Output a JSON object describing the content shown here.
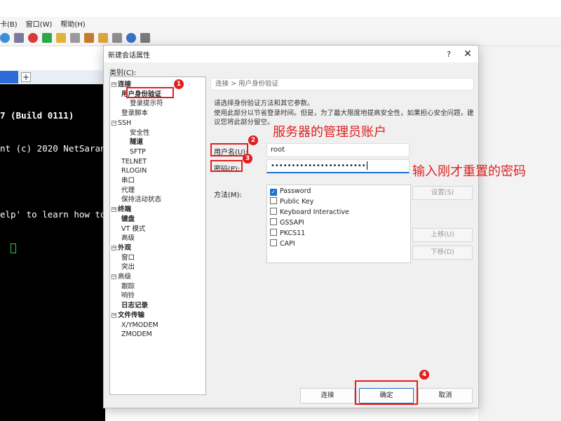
{
  "app": {
    "menu": [
      "卡(B)",
      "窗口(W)",
      "帮助(H)"
    ],
    "tab_label": "",
    "terminal_lines": [
      "7 (Build 0111)",
      "nt (c) 2020 NetSaran",
      "",
      "elp' to learn how to"
    ]
  },
  "dialog": {
    "title": "新建会话属性",
    "help": "?",
    "close": "✕",
    "category_label": "类别(C):",
    "tree": [
      {
        "label": "连接",
        "bold": true,
        "toggle": "−"
      },
      {
        "label": "用户身份验证",
        "bold": true
      },
      {
        "label": "登录提示符"
      },
      {
        "label": "登录脚本"
      },
      {
        "label": "SSH",
        "toggle": "−"
      },
      {
        "label": "安全性"
      },
      {
        "label": "隧道",
        "bold": true
      },
      {
        "label": "SFTP"
      },
      {
        "label": "TELNET"
      },
      {
        "label": "RLOGIN"
      },
      {
        "label": "串口"
      },
      {
        "label": "代理"
      },
      {
        "label": "保持活动状态"
      },
      {
        "label": "终端",
        "bold": true,
        "toggle": "−"
      },
      {
        "label": "键盘",
        "bold": true
      },
      {
        "label": "VT 模式"
      },
      {
        "label": "高级"
      },
      {
        "label": "外观",
        "bold": true,
        "toggle": "−"
      },
      {
        "label": "窗口"
      },
      {
        "label": "突出"
      },
      {
        "label": "高级",
        "toggle": "−"
      },
      {
        "label": "跟踪"
      },
      {
        "label": "响铃"
      },
      {
        "label": "日志记录",
        "bold": true
      },
      {
        "label": "文件传输",
        "bold": true,
        "toggle": "−"
      },
      {
        "label": "X/YMODEM"
      },
      {
        "label": "ZMODEM"
      }
    ],
    "header_path": "连接 > 用户身份验证",
    "desc1": "请选择身份验证方法和其它参数。",
    "desc2": "使用此部分以节省登录时间。但是，为了最大限度地提高安全性，如果担心安全问题，建议您将此部分留空。",
    "username_label": "用户名(U):",
    "username_value": "root",
    "password_label": "密码(P):",
    "password_value": "•••••••••••••••••••••••",
    "method_label": "方法(M):",
    "methods": [
      {
        "label": "Password",
        "checked": true
      },
      {
        "label": "Public Key",
        "checked": false
      },
      {
        "label": "Keyboard Interactive",
        "checked": false
      },
      {
        "label": "GSSAPI",
        "checked": false
      },
      {
        "label": "PKCS11",
        "checked": false
      },
      {
        "label": "CAPI",
        "checked": false
      }
    ],
    "settings_btn": "设置(S)",
    "up_btn": "上移(U)",
    "down_btn": "下移(D)",
    "connect_btn": "连接",
    "ok_btn": "确定",
    "cancel_btn": "取消"
  },
  "annotations": {
    "badges": [
      "1",
      "2",
      "3",
      "4"
    ],
    "admin_note": "服务器的管理员账户",
    "password_note": "输入刚才重置的密码"
  },
  "colors": {
    "annotation": "#e02020",
    "accent": "#1a6fd4"
  }
}
